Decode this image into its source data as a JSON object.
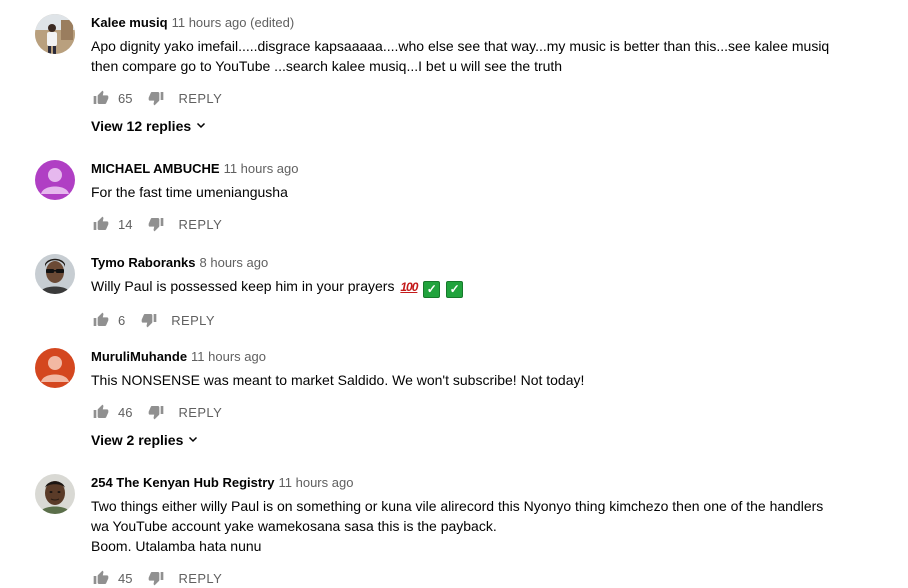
{
  "comments": [
    {
      "author": "Kalee musiq",
      "time": "11 hours ago (edited)",
      "lines": [
        "Apo dignity yako imefail.....disgrace kapsaaaaa....who else see that way...my music is better than this...see kalee musiq",
        "then compare go to YouTube ...search kalee musiq...I bet u will see the truth"
      ],
      "likes": "65",
      "reply_label": "REPLY",
      "view_replies": "View 12 replies",
      "avatar": "photo-man-standing"
    },
    {
      "author": "MICHAEL AMBUCHE",
      "time": "11 hours ago",
      "lines": [
        "For the fast time umeniangusha"
      ],
      "likes": "14",
      "reply_label": "REPLY",
      "avatar": "default-purple",
      "avatar_color": "#b03fc4"
    },
    {
      "author": "Tymo Raboranks",
      "time": "8 hours ago",
      "lines": [
        "Willy Paul is possessed keep him in your prayers"
      ],
      "emojis": [
        "100",
        "✓",
        "✓"
      ],
      "likes": "6",
      "reply_label": "REPLY",
      "avatar": "photo-man-sunglasses"
    },
    {
      "author": "MuruliMuhande",
      "time": "11 hours ago",
      "lines": [
        "This NONSENSE was meant to market Saldido. We won't subscribe! Not today!"
      ],
      "likes": "46",
      "reply_label": "REPLY",
      "view_replies": "View 2 replies",
      "avatar": "default-orange",
      "avatar_color": "#d4471f"
    },
    {
      "author": "254 The Kenyan Hub Registry",
      "time": "11 hours ago",
      "lines": [
        "Two things either willy Paul is  on something or kuna vile alirecord this Nyonyo thing kimchezo then one of the handlers",
        "wa YouTube account yake wamekosana sasa this is the payback.",
        "Boom. Utalamba hata nunu"
      ],
      "likes": "45",
      "reply_label": "REPLY",
      "avatar": "photo-man-face"
    }
  ],
  "icons": {
    "like": "thumbs-up-icon",
    "dislike": "thumbs-down-icon",
    "expand": "chevron-down-icon"
  },
  "colors": {
    "text": "#030303",
    "secondary": "#606060",
    "icon": "#909090"
  }
}
